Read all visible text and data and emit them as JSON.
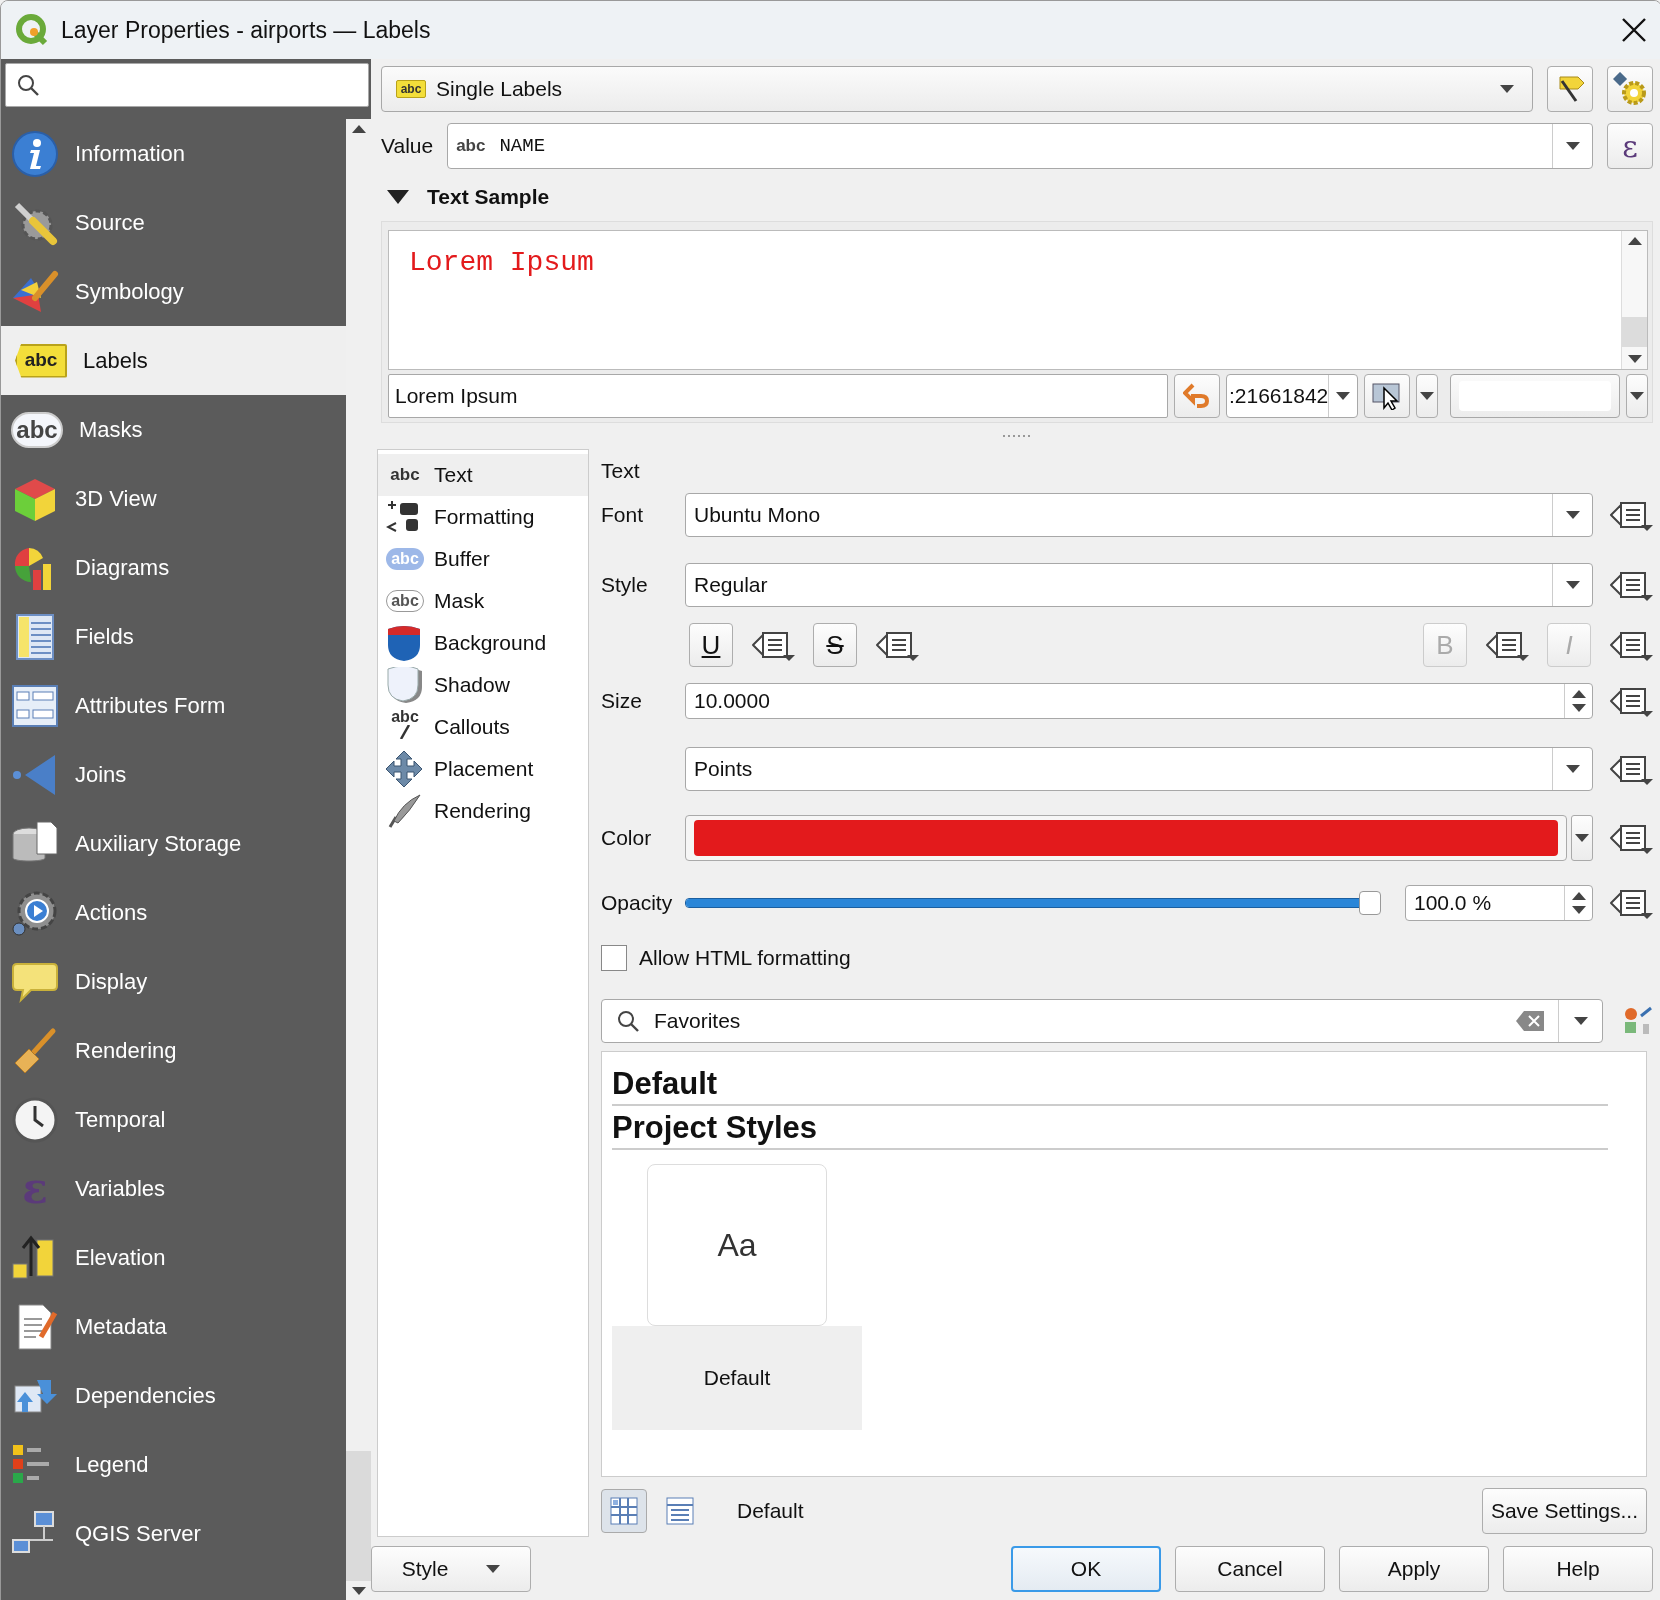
{
  "window": {
    "title": "Layer Properties - airports — Labels"
  },
  "sidebar": {
    "items": [
      {
        "label": "Information",
        "selected": false
      },
      {
        "label": "Source",
        "selected": false
      },
      {
        "label": "Symbology",
        "selected": false
      },
      {
        "label": "Labels",
        "selected": true,
        "icon_text": "abc"
      },
      {
        "label": "Masks",
        "selected": false,
        "icon_text": "abc"
      },
      {
        "label": "3D View",
        "selected": false
      },
      {
        "label": "Diagrams",
        "selected": false
      },
      {
        "label": "Fields",
        "selected": false
      },
      {
        "label": "Attributes Form",
        "selected": false
      },
      {
        "label": "Joins",
        "selected": false
      },
      {
        "label": "Auxiliary Storage",
        "selected": false
      },
      {
        "label": "Actions",
        "selected": false
      },
      {
        "label": "Display",
        "selected": false
      },
      {
        "label": "Rendering",
        "selected": false
      },
      {
        "label": "Temporal",
        "selected": false
      },
      {
        "label": "Variables",
        "selected": false,
        "icon_text": "ε"
      },
      {
        "label": "Elevation",
        "selected": false
      },
      {
        "label": "Metadata",
        "selected": false
      },
      {
        "label": "Dependencies",
        "selected": false
      },
      {
        "label": "Legend",
        "selected": false
      },
      {
        "label": "QGIS Server",
        "selected": false
      }
    ]
  },
  "labeling": {
    "mode": "Single Labels",
    "mode_icon_text": "abc",
    "value_label": "Value",
    "value_prefix": "abc",
    "value_field": "NAME",
    "expression_button": "ε"
  },
  "text_sample": {
    "title": "Text Sample",
    "expanded": true,
    "preview": "Lorem Ipsum",
    "input": "Lorem Ipsum",
    "scale": ":21661842"
  },
  "tabs": [
    {
      "label": "Text",
      "selected": true,
      "icon_text": "abc"
    },
    {
      "label": "Formatting",
      "selected": false
    },
    {
      "label": "Buffer",
      "selected": false,
      "icon_text": "abc"
    },
    {
      "label": "Mask",
      "selected": false,
      "icon_text": "abc"
    },
    {
      "label": "Background",
      "selected": false
    },
    {
      "label": "Shadow",
      "selected": false
    },
    {
      "label": "Callouts",
      "selected": false,
      "icon_text": "abc"
    },
    {
      "label": "Placement",
      "selected": false
    },
    {
      "label": "Rendering",
      "selected": false
    }
  ],
  "text_settings": {
    "heading": "Text",
    "font": {
      "label": "Font",
      "value": "Ubuntu Mono"
    },
    "style": {
      "label": "Style",
      "value": "Regular"
    },
    "format_buttons": [
      {
        "kind": "underline",
        "label": "U",
        "disabled": false
      },
      {
        "kind": "strike",
        "label": "S",
        "disabled": false
      },
      {
        "kind": "bold",
        "label": "B",
        "disabled": true
      },
      {
        "kind": "italic",
        "label": "I",
        "disabled": true
      }
    ],
    "size": {
      "label": "Size",
      "value": "10.0000"
    },
    "unit": {
      "value": "Points"
    },
    "color": {
      "label": "Color",
      "color": "#e31a1c"
    },
    "opacity": {
      "label": "Opacity",
      "level": 1.0,
      "reading": "100.0 %"
    },
    "allow_html": {
      "label": "Allow HTML formatting",
      "checked": false
    }
  },
  "style_library": {
    "search": "Favorites",
    "groups": [
      "Default",
      "Project Styles"
    ],
    "items": [
      {
        "preview": "Aa",
        "name": "Default",
        "selected": true
      }
    ],
    "view_buttons": [
      {
        "kind": "grid",
        "selected": true
      },
      {
        "kind": "list",
        "selected": false
      }
    ],
    "group_name": "Default",
    "save_button": "Save Settings..."
  },
  "style_button": "Style",
  "buttons": [
    {
      "label": "OK",
      "default": true
    },
    {
      "label": "Cancel",
      "default": false
    },
    {
      "label": "Apply",
      "default": false
    },
    {
      "label": "Help",
      "default": false
    }
  ]
}
